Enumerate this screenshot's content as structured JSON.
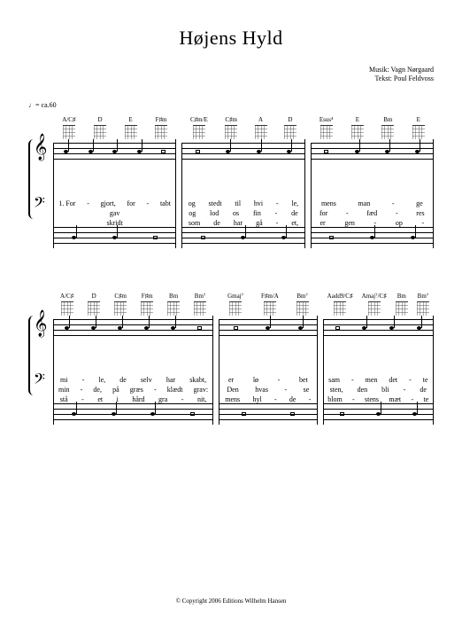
{
  "title": "Højens Hyld",
  "tempo": "♩= ca.60",
  "credits": {
    "music": "Musik: Vagn Nørgaard",
    "text": "Tekst: Poul Feldvoss"
  },
  "copyright": "© Copyright 2006 Editions Wilhelm Hansen",
  "systems": [
    {
      "measures": [
        {
          "chords": [
            "A/C♯",
            "D",
            "E",
            "F♯m"
          ],
          "lyrics": {
            "verse1": [
              "1. For",
              "-",
              "gjort,",
              "for",
              "-",
              "tabt"
            ],
            "verse2": [
              "",
              "",
              "gav"
            ],
            "verse3": [
              "",
              "",
              "skridt"
            ]
          }
        },
        {
          "chords": [
            "C♯m/E",
            "C♯m",
            "A",
            "D"
          ],
          "lyrics": {
            "verse1": [
              "og",
              "stedt",
              "til",
              "hvi",
              "-",
              "le,"
            ],
            "verse2": [
              "og",
              "lod",
              "os",
              "fin",
              "-",
              "de"
            ],
            "verse3": [
              "som",
              "de",
              "har",
              "gå",
              "-",
              "et,"
            ]
          }
        },
        {
          "chords": [
            "Esus⁴",
            "E",
            "Bm",
            "E"
          ],
          "lyrics": {
            "verse1": [
              "mens",
              "man",
              "-",
              "ge"
            ],
            "verse2": [
              "for",
              "-",
              "fæd",
              "-",
              "res"
            ],
            "verse3": [
              "er",
              "gen",
              "-",
              "op",
              "-"
            ]
          }
        }
      ]
    },
    {
      "measures": [
        {
          "chords": [
            "A/C♯",
            "D",
            "C♯m",
            "F♯m",
            "Bm",
            "Bm⁷"
          ],
          "lyrics": {
            "verse1": [
              "mi",
              "-",
              "le,",
              "de",
              "selv",
              "har",
              "skabt,"
            ],
            "verse2": [
              "min",
              "-",
              "de,",
              "på",
              "græs",
              "-",
              "klædt",
              "grav:"
            ],
            "verse3": [
              "stå",
              "-",
              "et",
              "i",
              "hård",
              "gra",
              "-",
              "nit,"
            ]
          }
        },
        {
          "chords": [
            "Gmaj⁷",
            "F♯m/A",
            "Bm⁷"
          ],
          "lyrics": {
            "verse1": [
              "er",
              "lø",
              "-",
              "bet"
            ],
            "verse2": [
              "Den",
              "hvas",
              "-",
              "se"
            ],
            "verse3": [
              "mens",
              "hyl",
              "-",
              "de",
              "-"
            ]
          }
        },
        {
          "chords": [
            "Aadd9/C♯",
            "Amaj⁷/C♯",
            "Bm",
            "Bm⁷"
          ],
          "lyrics": {
            "verse1": [
              "sam",
              "-",
              "men",
              "det",
              "-",
              "te"
            ],
            "verse2": [
              "sten,",
              "",
              "den",
              "bli",
              "-",
              "de"
            ],
            "verse3": [
              "blom",
              "-",
              "stens",
              "mæt",
              "-",
              "te"
            ]
          }
        }
      ]
    }
  ]
}
